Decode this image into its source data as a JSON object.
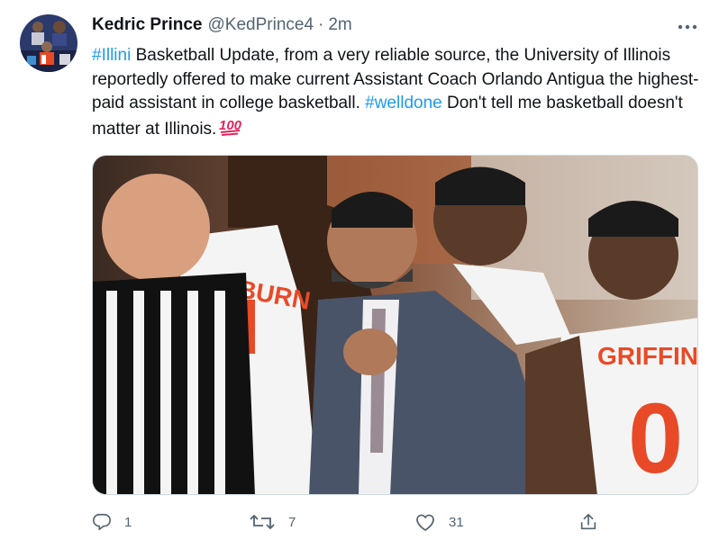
{
  "tweet": {
    "author_name": "Kedric Prince",
    "author_handle": "@KedPrince4",
    "separator": "·",
    "time": "2m",
    "text": {
      "hashtag1": "#Illini",
      "part1": " Basketball Update, from a very reliable source, the University of Illinois  reportedly offered to make current Assistant Coach Orlando Antigua the highest-paid assistant in college basketball. ",
      "hashtag2": "#welldone",
      "part2": " Don't tell me basketball doesn't matter at Illinois."
    },
    "emoji": "100",
    "media": {
      "jersey_name_left": "CKBURN",
      "jersey_name_right": "GRIFFIN",
      "jersey_number_right": "0"
    },
    "actions": {
      "replies": "1",
      "retweets": "7",
      "likes": "31"
    },
    "icons": {
      "more": "more-icon",
      "reply": "reply-icon",
      "retweet": "retweet-icon",
      "like": "like-icon",
      "share": "share-icon"
    },
    "colors": {
      "link": "#1d9bf0",
      "secondary": "#536471",
      "emoji_red": "#e0245e",
      "illini_orange": "#e84a27"
    }
  }
}
